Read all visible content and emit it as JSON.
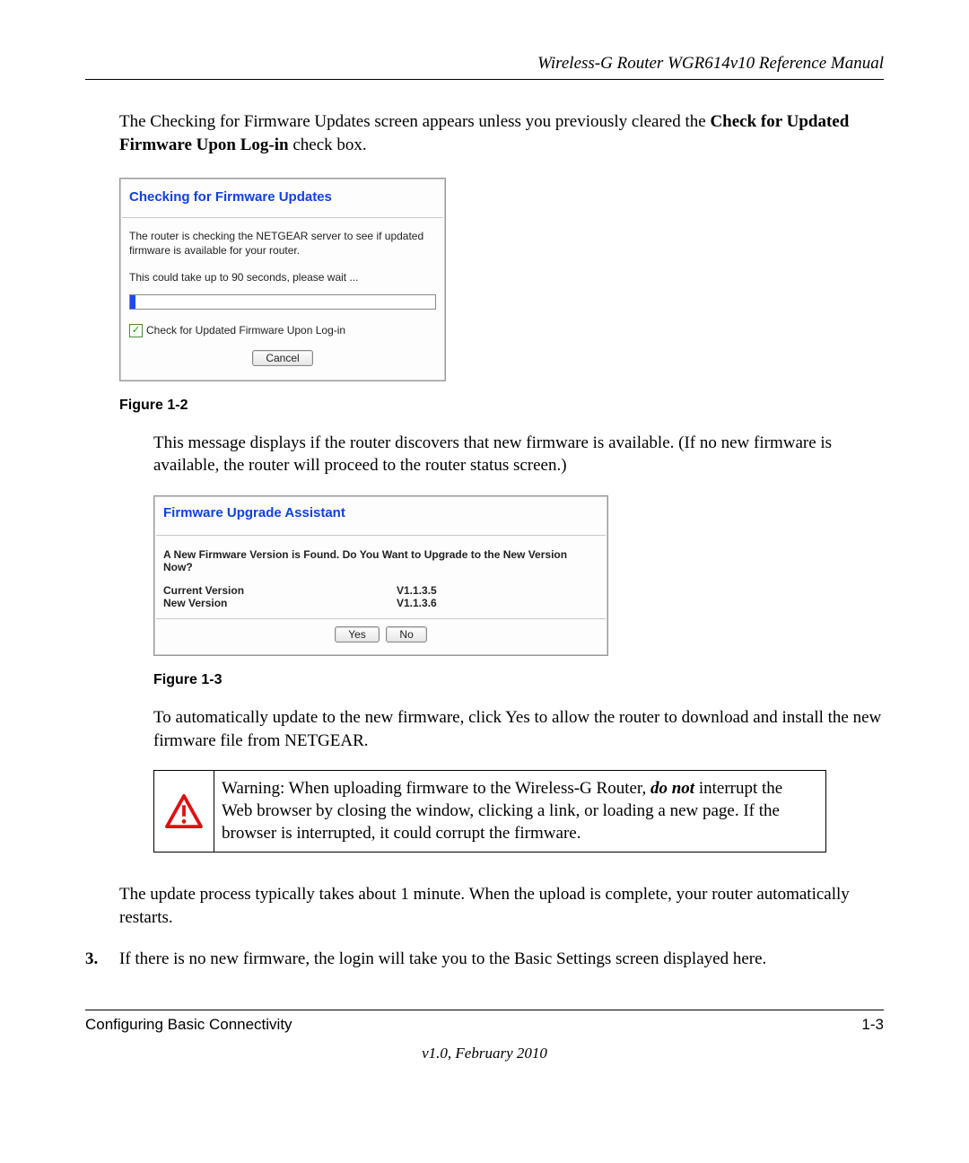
{
  "header": {
    "doc_title": "Wireless-G Router WGR614v10 Reference Manual"
  },
  "intro": {
    "before_bold": "The Checking for Firmware Updates screen appears unless you previously cleared the ",
    "bold": "Check for Updated Firmware Upon Log-in",
    "after_bold": " check box."
  },
  "fig1": {
    "title": "Checking for Firmware Updates",
    "line1": "The router is checking the NETGEAR server to see if updated firmware is available for your router.",
    "line2": "This could take up to 90 seconds, please wait ...",
    "checkbox_label": "Check for Updated Firmware Upon Log-in",
    "cancel_label": "Cancel",
    "caption": "Figure 1-2"
  },
  "mid1": "This message displays if the router discovers that new firmware is available. (If no new firmware is available, the router will proceed to the router status screen.)",
  "fig2": {
    "title": "Firmware Upgrade Assistant",
    "prompt": "A New Firmware Version is Found. Do You Want to Upgrade to the New Version Now?",
    "current_label": "Current Version",
    "current_value": "V1.1.3.5",
    "new_label": "New Version",
    "new_value": "V1.1.3.6",
    "yes_label": "Yes",
    "no_label": "No",
    "caption": "Figure 1-3"
  },
  "mid2": {
    "before_bold": "To automatically update to the new firmware, click ",
    "bold": "Yes",
    "after_bold": " to allow the router to download and install the new firmware file from NETGEAR."
  },
  "warning": {
    "label": "Warning:",
    "before_italic": " When uploading firmware to the Wireless-G Router, ",
    "italic": "do not",
    "after_italic": " interrupt the Web browser by closing the window, clicking a link, or loading a new page. If the browser is interrupted, it could corrupt the firmware."
  },
  "mid3": "The update process typically takes about 1 minute. When the upload is complete, your router automatically restarts.",
  "step3": {
    "num": "3.",
    "text": "If there is no new firmware, the login will take you to the Basic Settings screen displayed here."
  },
  "footer": {
    "section": "Configuring Basic Connectivity",
    "page": "1-3",
    "version": "v1.0, February 2010"
  }
}
